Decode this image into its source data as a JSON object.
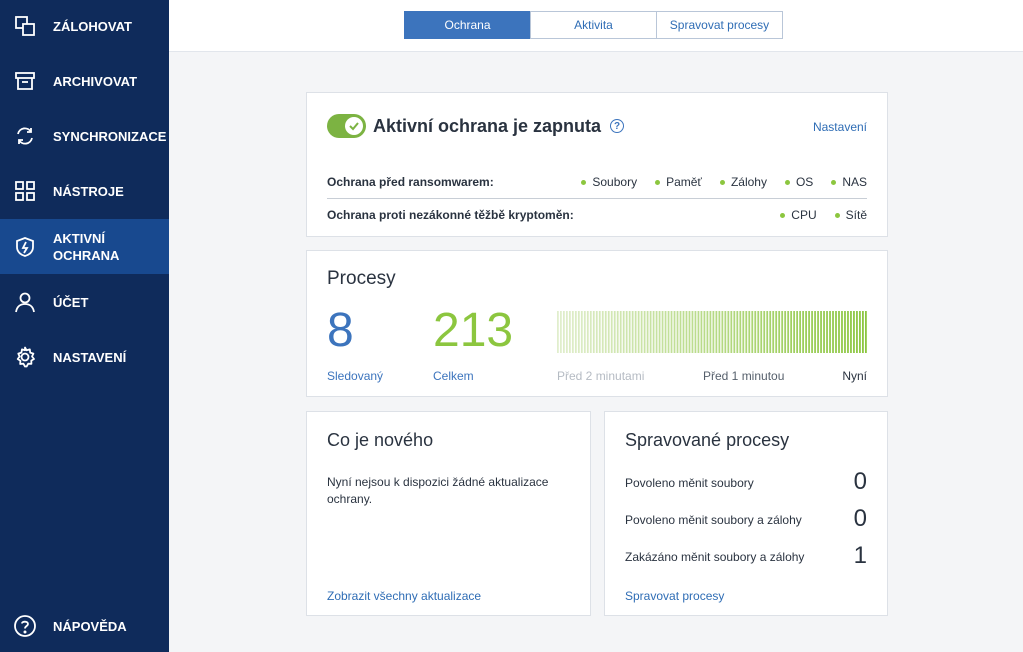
{
  "sidebar": {
    "items": [
      {
        "label": "ZÁLOHOVAT",
        "icon": "backup-icon"
      },
      {
        "label": "ARCHIVOVAT",
        "icon": "archive-icon"
      },
      {
        "label": "SYNCHRONIZACE",
        "icon": "sync-icon"
      },
      {
        "label": "NÁSTROJE",
        "icon": "tools-grid-icon"
      },
      {
        "label_line1": "AKTIVNÍ",
        "label_line2": "OCHRANA",
        "icon": "shield-icon",
        "active": true
      },
      {
        "label": "ÚČET",
        "icon": "account-icon"
      },
      {
        "label": "NASTAVENÍ",
        "icon": "gear-icon"
      }
    ],
    "help_label": "NÁPOVĚDA"
  },
  "tabs": [
    "Ochrana",
    "Aktivita",
    "Spravovat procesy"
  ],
  "protection": {
    "title": "Aktivní ochrana je zapnuta",
    "settings_link": "Nastavení",
    "toggle_on": true,
    "ransomware_label": "Ochrana před ransomwarem:",
    "ransomware_items": [
      "Soubory",
      "Paměť",
      "Zálohy",
      "OS",
      "NAS"
    ],
    "crypto_label": "Ochrana proti nezákonné těžbě kryptoměn:",
    "crypto_items": [
      "CPU",
      "Sítě"
    ]
  },
  "processes": {
    "title": "Procesy",
    "monitored_count": "8",
    "monitored_label": "Sledovaný",
    "total_count": "213",
    "total_label": "Celkem",
    "time_labels": [
      "Před 2 minutami",
      "Před 1 minutou",
      "Nyní"
    ]
  },
  "whats_new": {
    "title": "Co je nového",
    "text": "Nyní nejsou k dispozici žádné aktualizace ochrany.",
    "link": "Zobrazit všechny aktualizace"
  },
  "managed": {
    "title": "Spravované procesy",
    "rows": [
      {
        "label": "Povoleno měnit soubory",
        "count": "0"
      },
      {
        "label": "Povoleno měnit soubory a zálohy",
        "count": "0"
      },
      {
        "label": "Zakázáno měnit soubory a zálohy",
        "count": "1"
      }
    ],
    "link": "Spravovat procesy"
  },
  "colors": {
    "sidebar": "#0f2b5b",
    "sidebar_active": "#18498f",
    "accent_blue": "#3c74bd",
    "accent_green": "#8cc63f"
  }
}
